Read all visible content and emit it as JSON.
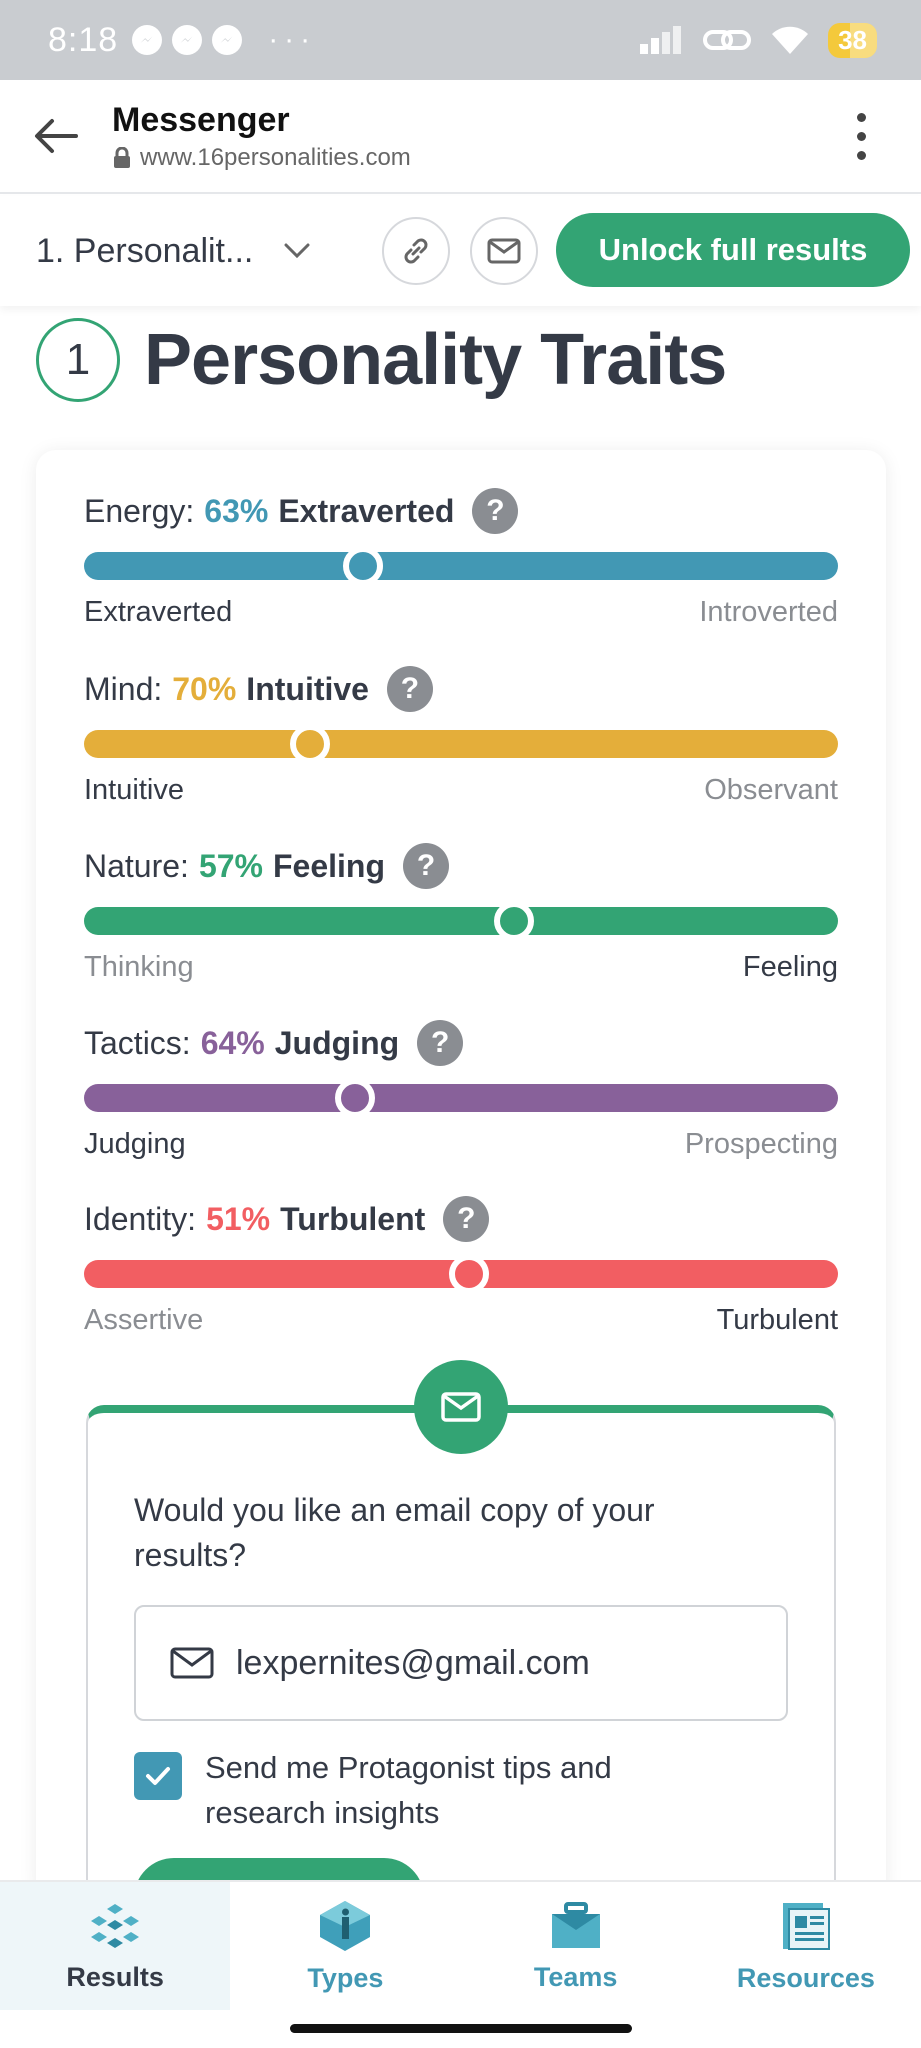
{
  "status_bar": {
    "time": "8:18",
    "more": "···",
    "battery": "38"
  },
  "browser": {
    "title": "Messenger",
    "url": "www.16personalities.com"
  },
  "toolbar": {
    "section_select": "1. Personalit...",
    "unlock_label": "Unlock full results"
  },
  "heading": {
    "number": "1",
    "title": "Personality Traits"
  },
  "traits": [
    {
      "prefix": "Energy:",
      "percent": "63%",
      "side": "Extraverted",
      "left": "Extraverted",
      "right": "Introverted",
      "color": "#4298b4",
      "position": 0.37,
      "active": "left"
    },
    {
      "prefix": "Mind:",
      "percent": "70%",
      "side": "Intuitive",
      "left": "Intuitive",
      "right": "Observant",
      "color": "#e4ae3a",
      "position": 0.3,
      "active": "left"
    },
    {
      "prefix": "Nature:",
      "percent": "57%",
      "side": "Feeling",
      "left": "Thinking",
      "right": "Feeling",
      "color": "#33a474",
      "position": 0.57,
      "active": "right"
    },
    {
      "prefix": "Tactics:",
      "percent": "64%",
      "side": "Judging",
      "left": "Judging",
      "right": "Prospecting",
      "color": "#88619a",
      "position": 0.36,
      "active": "left"
    },
    {
      "prefix": "Identity:",
      "percent": "51%",
      "side": "Turbulent",
      "left": "Assertive",
      "right": "Turbulent",
      "color": "#f25e62",
      "position": 0.51,
      "active": "right"
    }
  ],
  "help_glyph": "?",
  "email": {
    "prompt": "Would you like an email copy of your results?",
    "value": "lexpernites@gmail.com",
    "checkbox_label": "Send me Protagonist tips and research insights",
    "checked": true
  },
  "bottom_nav": [
    {
      "label": "Results",
      "active": true
    },
    {
      "label": "Types",
      "active": false
    },
    {
      "label": "Teams",
      "active": false
    },
    {
      "label": "Resources",
      "active": false
    }
  ]
}
